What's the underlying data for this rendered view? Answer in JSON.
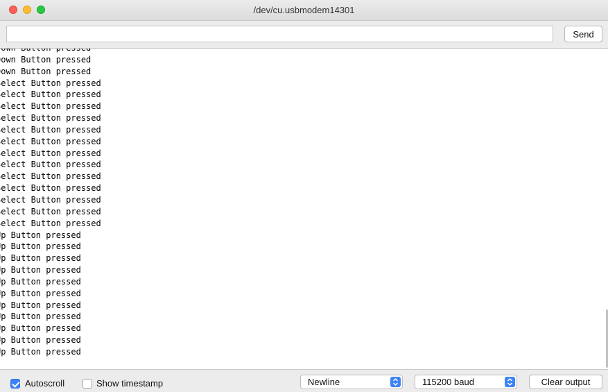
{
  "window": {
    "title": "/dev/cu.usbmodem14301"
  },
  "input_bar": {
    "input_value": "",
    "send_label": "Send"
  },
  "output_lines": [
    "Down Button pressed",
    "Down Button pressed",
    "Down Button pressed",
    "Select Button pressed",
    "Select Button pressed",
    "Select Button pressed",
    "Select Button pressed",
    "Select Button pressed",
    "Select Button pressed",
    "Select Button pressed",
    "Select Button pressed",
    "Select Button pressed",
    "Select Button pressed",
    "Select Button pressed",
    "Select Button pressed",
    "Select Button pressed",
    "Up Button pressed",
    "Up Button pressed",
    "Up Button pressed",
    "Up Button pressed",
    "Up Button pressed",
    "Up Button pressed",
    "Up Button pressed",
    "Up Button pressed",
    "Up Button pressed",
    "Up Button pressed",
    "Up Button pressed"
  ],
  "status_bar": {
    "autoscroll_label": "Autoscroll",
    "autoscroll_checked": true,
    "timestamp_label": "Show timestamp",
    "timestamp_checked": false,
    "line_ending": "Newline",
    "baud_rate": "115200 baud",
    "clear_label": "Clear output"
  },
  "colors": {
    "accent": "#3d83f7"
  }
}
